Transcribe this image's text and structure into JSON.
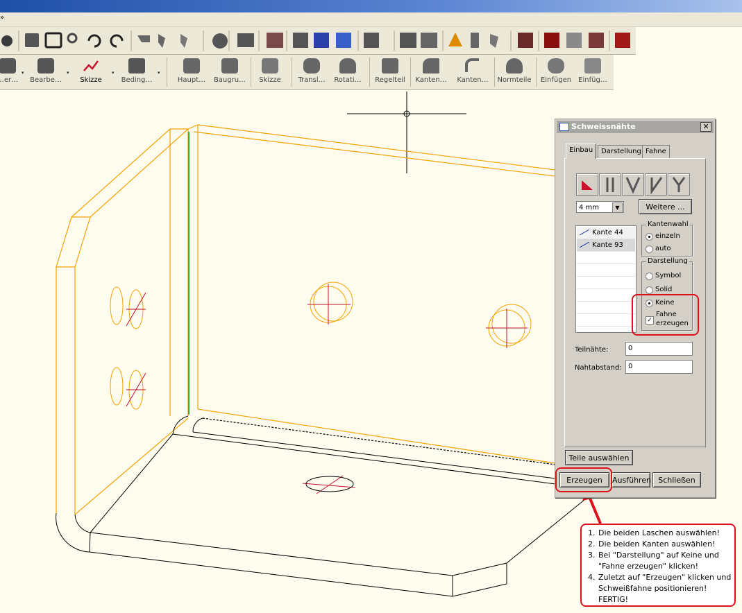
{
  "menu": {
    "overflow_glyph": "»"
  },
  "toolbar_large": [
    {
      "label": "…er…",
      "dropdown": true
    },
    {
      "label": "Bearbe…",
      "dropdown": true
    },
    {
      "label": "Skizze",
      "dropdown": true,
      "active": true
    },
    {
      "label": "Beding…",
      "dropdown": true
    },
    {
      "label": "Haupt…"
    },
    {
      "label": "Baugru…"
    },
    {
      "label": "Skizze"
    },
    {
      "label": "Transl…"
    },
    {
      "label": "Rotati…"
    },
    {
      "label": "Regelteil"
    },
    {
      "label": "Kanten…"
    },
    {
      "label": "Kanten…"
    },
    {
      "label": "Normteile"
    },
    {
      "label": "Einfügen"
    },
    {
      "label": "Einfüg…"
    }
  ],
  "dialog": {
    "title": "Schweissnähte",
    "close_glyph": "✕",
    "tabs": [
      "Einbau",
      "Darstellung",
      "Fahne"
    ],
    "size_value": "4 mm",
    "more_button": "Weitere ...",
    "edges": [
      "Kante 44",
      "Kante 93"
    ],
    "kantenwahl": {
      "label": "Kantenwahl",
      "options": [
        "einzeln",
        "auto"
      ],
      "selected": "einzeln"
    },
    "darstellung": {
      "label": "Darstellung",
      "options": [
        "Symbol",
        "Solid",
        "Keine"
      ],
      "selected": "Keine"
    },
    "fahne_checkbox": {
      "line1": "Fahne",
      "line2": "erzeugen",
      "checked": true,
      "mark": "✓"
    },
    "teilnaehte": {
      "label": "Teilnähte:",
      "value": "0"
    },
    "nahtabstand": {
      "label": "Nahtabstand:",
      "value": "0"
    },
    "select_parts_button": "Teile auswählen",
    "buttons": {
      "create": "Erzeugen",
      "execute": "Ausführen",
      "close": "Schließen"
    }
  },
  "note": {
    "steps": [
      "Die beiden Laschen auswählen!",
      "Die beiden Kanten auswählen!",
      "Bei \"Darstellung\" auf Keine und \"Fahne erzeugen\" klicken!",
      "Zuletzt auf \"Erzeugen\" klicken und Schweißfahne positionieren! FERTIG!"
    ]
  },
  "colors": {
    "part_edge": "#f5a200",
    "selected_edge": "#2cb82c",
    "hole_axis": "#c8102e",
    "highlight": "#e0101a"
  }
}
